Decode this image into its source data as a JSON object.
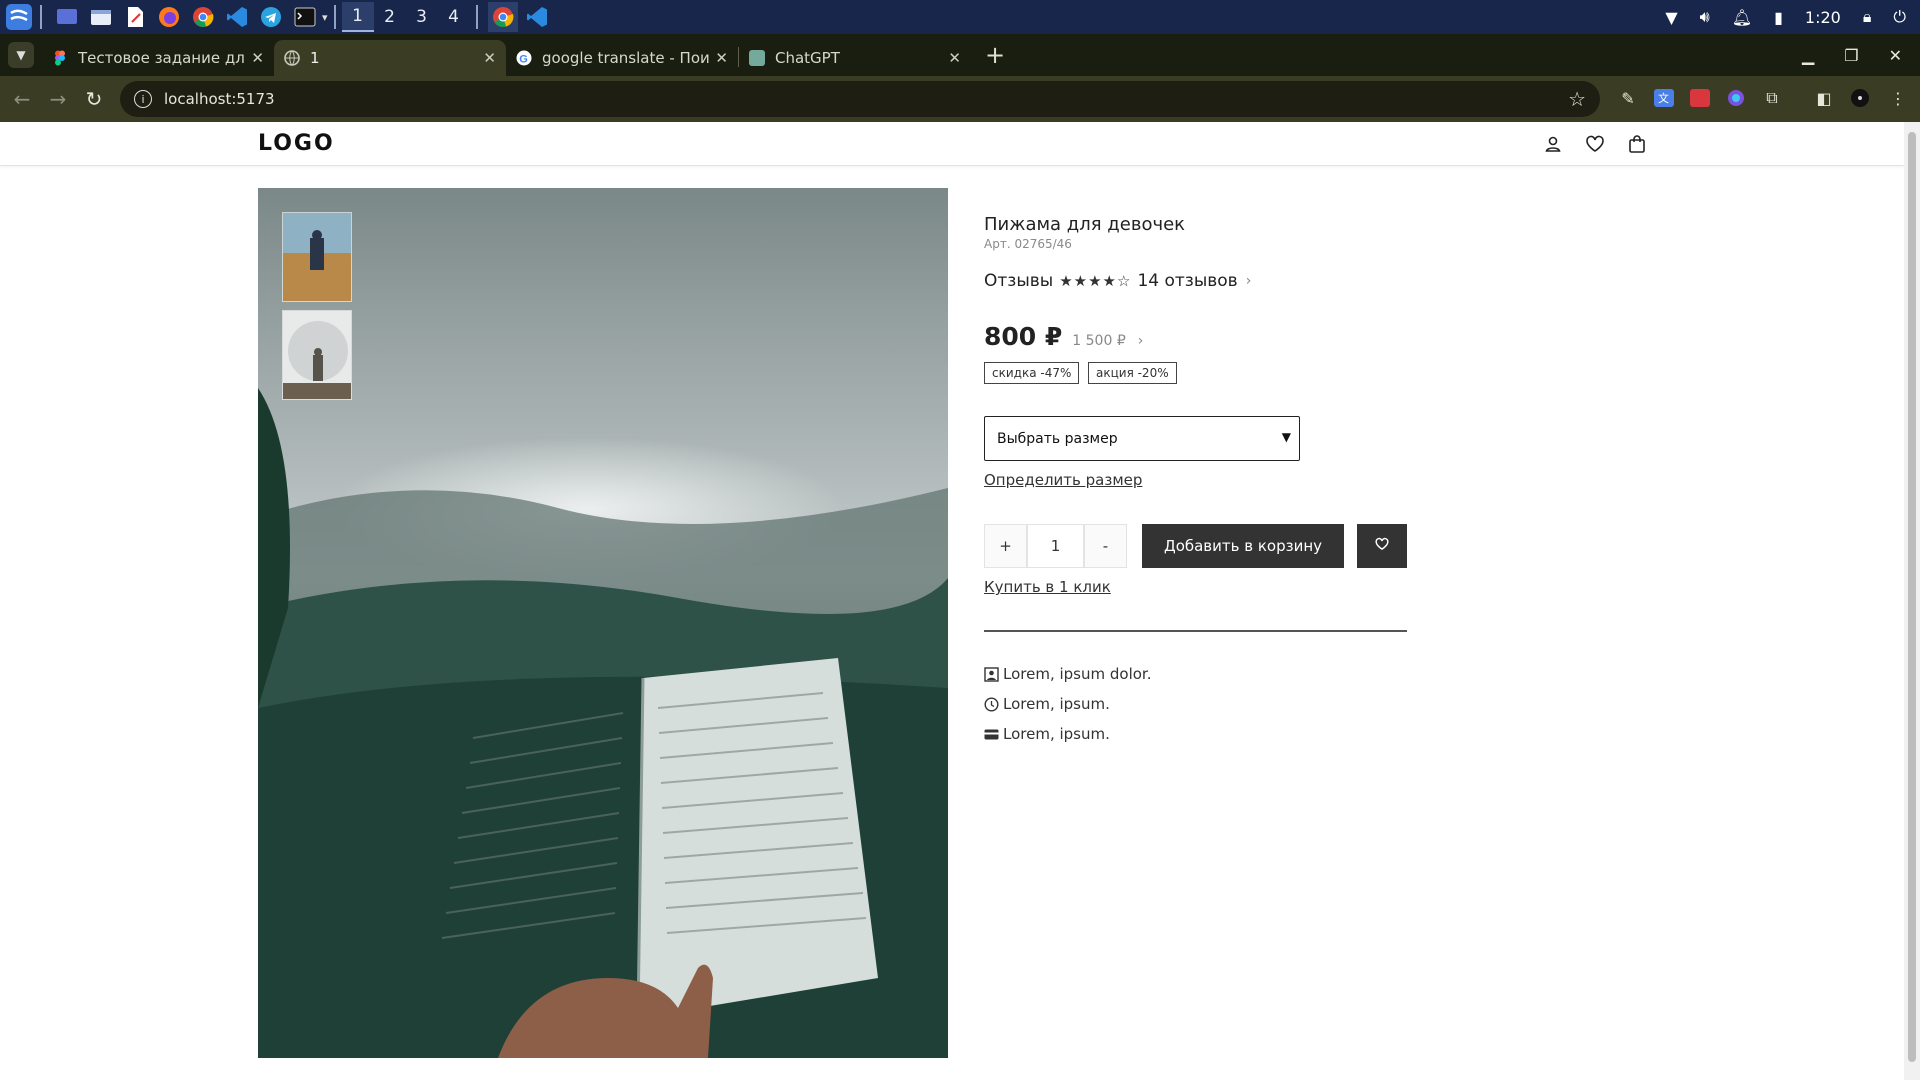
{
  "taskbar": {
    "workspaces": [
      "1",
      "2",
      "3",
      "4"
    ],
    "clock": "1:20"
  },
  "browser": {
    "tabs": [
      {
        "title": "Тестовое задание для р",
        "favicon": "figma-icon"
      },
      {
        "title": "1",
        "favicon": "globe-icon",
        "active": true
      },
      {
        "title": "google translate - Поиск",
        "favicon": "google-icon"
      },
      {
        "title": "ChatGPT",
        "favicon": "chatgpt-icon"
      }
    ],
    "url": "localhost:5173"
  },
  "site": {
    "logo": "LOGO"
  },
  "product": {
    "title": "Пижама для девочек",
    "article": "Арт. 02765/46",
    "reviews_label": "Отзывы",
    "rating": 4,
    "rating_max": 5,
    "reviews_count": "14 отзывов",
    "price": "800 ₽",
    "old_price": "1 500 ₽",
    "badges": [
      "скидка -47%",
      "акция -20%"
    ],
    "size_select": "Выбрать размер",
    "size_link": "Определить размер",
    "quantity": "1",
    "qty_plus": "+",
    "qty_minus": "-",
    "add_to_cart": "Добавить в корзину",
    "buy_one_click": "Купить в 1 клик",
    "features": [
      {
        "icon": "user-badge-icon",
        "text": "Lorem, ipsum dolor."
      },
      {
        "icon": "clock-icon",
        "text": "Lorem, ipsum."
      },
      {
        "icon": "card-icon",
        "text": "Lorem, ipsum."
      }
    ]
  }
}
